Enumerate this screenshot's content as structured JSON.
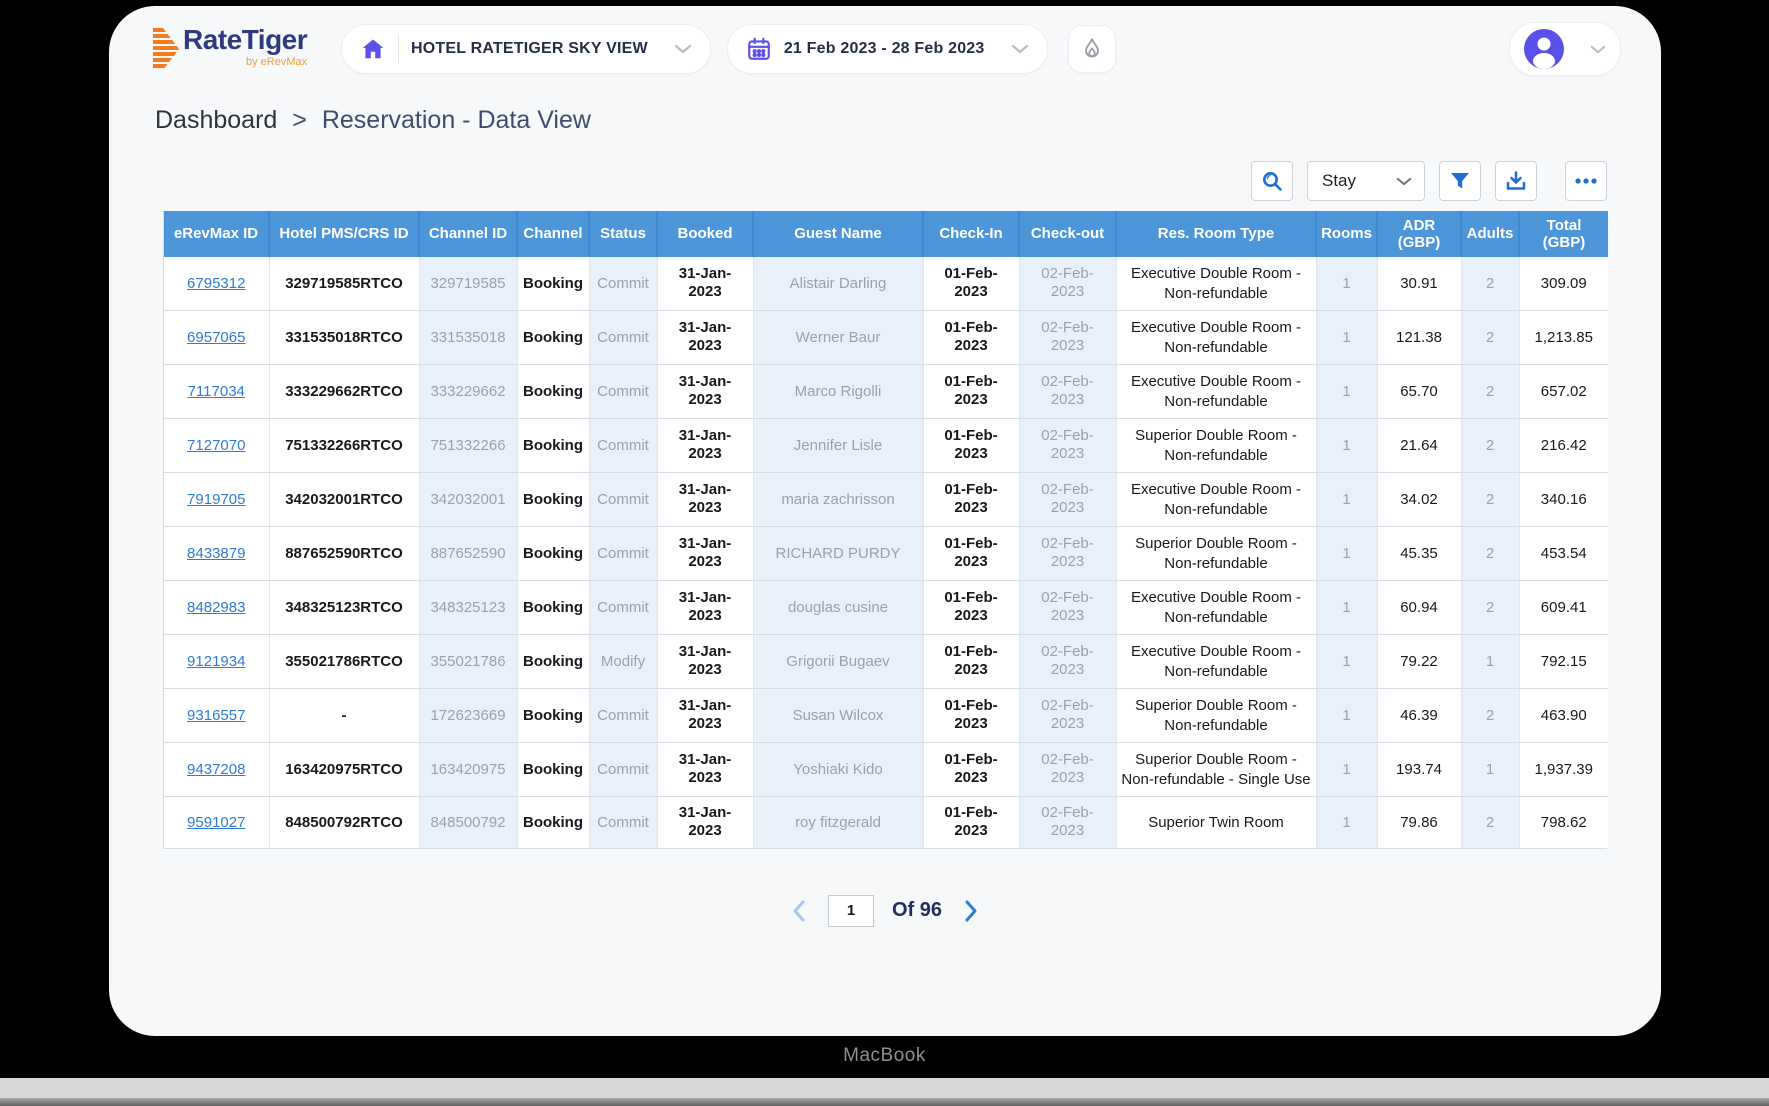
{
  "device": {
    "label": "MacBook"
  },
  "colors": {
    "accent_purple": "#5b50e8",
    "header_blue": "#4e96da",
    "link_blue": "#2e7cd6",
    "icon_blue": "#1c6fd1",
    "shaded_column": "#e8f1fa"
  },
  "header": {
    "logo": {
      "brand": "RateTiger",
      "tagline": "by eRevMax"
    },
    "hotel_selector": {
      "value": "HOTEL RATETIGER SKY VIEW"
    },
    "date_range": {
      "value": "21 Feb 2023 - 28 Feb 2023"
    }
  },
  "breadcrumb": {
    "root": "Dashboard",
    "separator": ">",
    "current": "Reservation - Data View"
  },
  "toolbar": {
    "view_select": {
      "value": "Stay"
    }
  },
  "table": {
    "columns": [
      "eRevMax ID",
      "Hotel PMS/CRS ID",
      "Channel ID",
      "Channel",
      "Status",
      "Booked",
      "Guest Name",
      "Check-In",
      "Check-out",
      "Res. Room Type",
      "Rooms",
      "ADR (GBP)",
      "Adults",
      "Total (GBP)"
    ],
    "rows": [
      [
        "6795312",
        "329719585RTCO",
        "329719585",
        "Booking",
        "Commit",
        "31-Jan-2023",
        "Alistair Darling",
        "01-Feb-2023",
        "02-Feb-2023",
        "Executive Double Room - Non-refundable",
        "1",
        "30.91",
        "2",
        "309.09"
      ],
      [
        "6957065",
        "331535018RTCO",
        "331535018",
        "Booking",
        "Commit",
        "31-Jan-2023",
        "Werner Baur",
        "01-Feb-2023",
        "02-Feb-2023",
        "Executive Double Room - Non-refundable",
        "1",
        "121.38",
        "2",
        "1,213.85"
      ],
      [
        "7117034",
        "333229662RTCO",
        "333229662",
        "Booking",
        "Commit",
        "31-Jan-2023",
        "Marco Rigolli",
        "01-Feb-2023",
        "02-Feb-2023",
        "Executive Double Room - Non-refundable",
        "1",
        "65.70",
        "2",
        "657.02"
      ],
      [
        "7127070",
        "751332266RTCO",
        "751332266",
        "Booking",
        "Commit",
        "31-Jan-2023",
        "Jennifer Lisle",
        "01-Feb-2023",
        "02-Feb-2023",
        "Superior Double Room - Non-refundable",
        "1",
        "21.64",
        "2",
        "216.42"
      ],
      [
        "7919705",
        "342032001RTCO",
        "342032001",
        "Booking",
        "Commit",
        "31-Jan-2023",
        "maria zachrisson",
        "01-Feb-2023",
        "02-Feb-2023",
        "Executive Double Room - Non-refundable",
        "1",
        "34.02",
        "2",
        "340.16"
      ],
      [
        "8433879",
        "887652590RTCO",
        "887652590",
        "Booking",
        "Commit",
        "31-Jan-2023",
        "RICHARD PURDY",
        "01-Feb-2023",
        "02-Feb-2023",
        "Superior Double Room - Non-refundable",
        "1",
        "45.35",
        "2",
        "453.54"
      ],
      [
        "8482983",
        "348325123RTCO",
        "348325123",
        "Booking",
        "Commit",
        "31-Jan-2023",
        "douglas cusine",
        "01-Feb-2023",
        "02-Feb-2023",
        "Executive Double Room - Non-refundable",
        "1",
        "60.94",
        "2",
        "609.41"
      ],
      [
        "9121934",
        "355021786RTCO",
        "355021786",
        "Booking",
        "Modify",
        "31-Jan-2023",
        "Grigorii Bugaev",
        "01-Feb-2023",
        "02-Feb-2023",
        "Executive Double Room - Non-refundable",
        "1",
        "79.22",
        "1",
        "792.15"
      ],
      [
        "9316557",
        "-",
        "172623669",
        "Booking",
        "Commit",
        "31-Jan-2023",
        "Susan Wilcox",
        "01-Feb-2023",
        "02-Feb-2023",
        "Superior Double Room - Non-refundable",
        "1",
        "46.39",
        "2",
        "463.90"
      ],
      [
        "9437208",
        "163420975RTCO",
        "163420975",
        "Booking",
        "Commit",
        "31-Jan-2023",
        "Yoshiaki Kido",
        "01-Feb-2023",
        "02-Feb-2023",
        "Superior Double Room - Non-refundable - Single Use",
        "1",
        "193.74",
        "1",
        "1,937.39"
      ],
      [
        "9591027",
        "848500792RTCO",
        "848500792",
        "Booking",
        "Commit",
        "31-Jan-2023",
        "roy fitzgerald",
        "01-Feb-2023",
        "02-Feb-2023",
        "Superior Twin Room",
        "1",
        "79.86",
        "2",
        "798.62"
      ]
    ]
  },
  "pagination": {
    "page": "1",
    "of_label": "Of 96"
  }
}
